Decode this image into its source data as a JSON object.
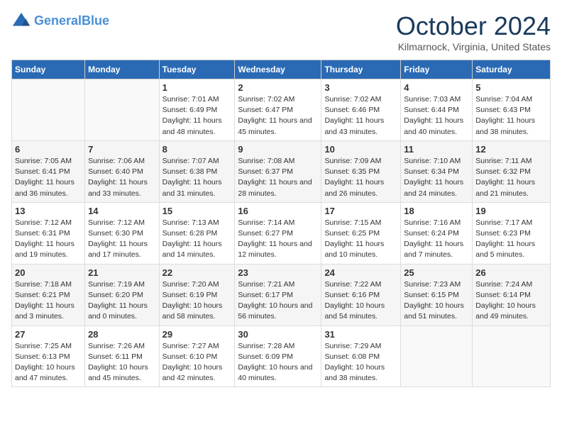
{
  "header": {
    "logo_line1": "General",
    "logo_line2": "Blue",
    "month": "October 2024",
    "location": "Kilmarnock, Virginia, United States"
  },
  "weekdays": [
    "Sunday",
    "Monday",
    "Tuesday",
    "Wednesday",
    "Thursday",
    "Friday",
    "Saturday"
  ],
  "weeks": [
    [
      {
        "day": "",
        "info": ""
      },
      {
        "day": "",
        "info": ""
      },
      {
        "day": "1",
        "info": "Sunrise: 7:01 AM\nSunset: 6:49 PM\nDaylight: 11 hours and 48 minutes."
      },
      {
        "day": "2",
        "info": "Sunrise: 7:02 AM\nSunset: 6:47 PM\nDaylight: 11 hours and 45 minutes."
      },
      {
        "day": "3",
        "info": "Sunrise: 7:02 AM\nSunset: 6:46 PM\nDaylight: 11 hours and 43 minutes."
      },
      {
        "day": "4",
        "info": "Sunrise: 7:03 AM\nSunset: 6:44 PM\nDaylight: 11 hours and 40 minutes."
      },
      {
        "day": "5",
        "info": "Sunrise: 7:04 AM\nSunset: 6:43 PM\nDaylight: 11 hours and 38 minutes."
      }
    ],
    [
      {
        "day": "6",
        "info": "Sunrise: 7:05 AM\nSunset: 6:41 PM\nDaylight: 11 hours and 36 minutes."
      },
      {
        "day": "7",
        "info": "Sunrise: 7:06 AM\nSunset: 6:40 PM\nDaylight: 11 hours and 33 minutes."
      },
      {
        "day": "8",
        "info": "Sunrise: 7:07 AM\nSunset: 6:38 PM\nDaylight: 11 hours and 31 minutes."
      },
      {
        "day": "9",
        "info": "Sunrise: 7:08 AM\nSunset: 6:37 PM\nDaylight: 11 hours and 28 minutes."
      },
      {
        "day": "10",
        "info": "Sunrise: 7:09 AM\nSunset: 6:35 PM\nDaylight: 11 hours and 26 minutes."
      },
      {
        "day": "11",
        "info": "Sunrise: 7:10 AM\nSunset: 6:34 PM\nDaylight: 11 hours and 24 minutes."
      },
      {
        "day": "12",
        "info": "Sunrise: 7:11 AM\nSunset: 6:32 PM\nDaylight: 11 hours and 21 minutes."
      }
    ],
    [
      {
        "day": "13",
        "info": "Sunrise: 7:12 AM\nSunset: 6:31 PM\nDaylight: 11 hours and 19 minutes."
      },
      {
        "day": "14",
        "info": "Sunrise: 7:12 AM\nSunset: 6:30 PM\nDaylight: 11 hours and 17 minutes."
      },
      {
        "day": "15",
        "info": "Sunrise: 7:13 AM\nSunset: 6:28 PM\nDaylight: 11 hours and 14 minutes."
      },
      {
        "day": "16",
        "info": "Sunrise: 7:14 AM\nSunset: 6:27 PM\nDaylight: 11 hours and 12 minutes."
      },
      {
        "day": "17",
        "info": "Sunrise: 7:15 AM\nSunset: 6:25 PM\nDaylight: 11 hours and 10 minutes."
      },
      {
        "day": "18",
        "info": "Sunrise: 7:16 AM\nSunset: 6:24 PM\nDaylight: 11 hours and 7 minutes."
      },
      {
        "day": "19",
        "info": "Sunrise: 7:17 AM\nSunset: 6:23 PM\nDaylight: 11 hours and 5 minutes."
      }
    ],
    [
      {
        "day": "20",
        "info": "Sunrise: 7:18 AM\nSunset: 6:21 PM\nDaylight: 11 hours and 3 minutes."
      },
      {
        "day": "21",
        "info": "Sunrise: 7:19 AM\nSunset: 6:20 PM\nDaylight: 11 hours and 0 minutes."
      },
      {
        "day": "22",
        "info": "Sunrise: 7:20 AM\nSunset: 6:19 PM\nDaylight: 10 hours and 58 minutes."
      },
      {
        "day": "23",
        "info": "Sunrise: 7:21 AM\nSunset: 6:17 PM\nDaylight: 10 hours and 56 minutes."
      },
      {
        "day": "24",
        "info": "Sunrise: 7:22 AM\nSunset: 6:16 PM\nDaylight: 10 hours and 54 minutes."
      },
      {
        "day": "25",
        "info": "Sunrise: 7:23 AM\nSunset: 6:15 PM\nDaylight: 10 hours and 51 minutes."
      },
      {
        "day": "26",
        "info": "Sunrise: 7:24 AM\nSunset: 6:14 PM\nDaylight: 10 hours and 49 minutes."
      }
    ],
    [
      {
        "day": "27",
        "info": "Sunrise: 7:25 AM\nSunset: 6:13 PM\nDaylight: 10 hours and 47 minutes."
      },
      {
        "day": "28",
        "info": "Sunrise: 7:26 AM\nSunset: 6:11 PM\nDaylight: 10 hours and 45 minutes."
      },
      {
        "day": "29",
        "info": "Sunrise: 7:27 AM\nSunset: 6:10 PM\nDaylight: 10 hours and 42 minutes."
      },
      {
        "day": "30",
        "info": "Sunrise: 7:28 AM\nSunset: 6:09 PM\nDaylight: 10 hours and 40 minutes."
      },
      {
        "day": "31",
        "info": "Sunrise: 7:29 AM\nSunset: 6:08 PM\nDaylight: 10 hours and 38 minutes."
      },
      {
        "day": "",
        "info": ""
      },
      {
        "day": "",
        "info": ""
      }
    ]
  ]
}
